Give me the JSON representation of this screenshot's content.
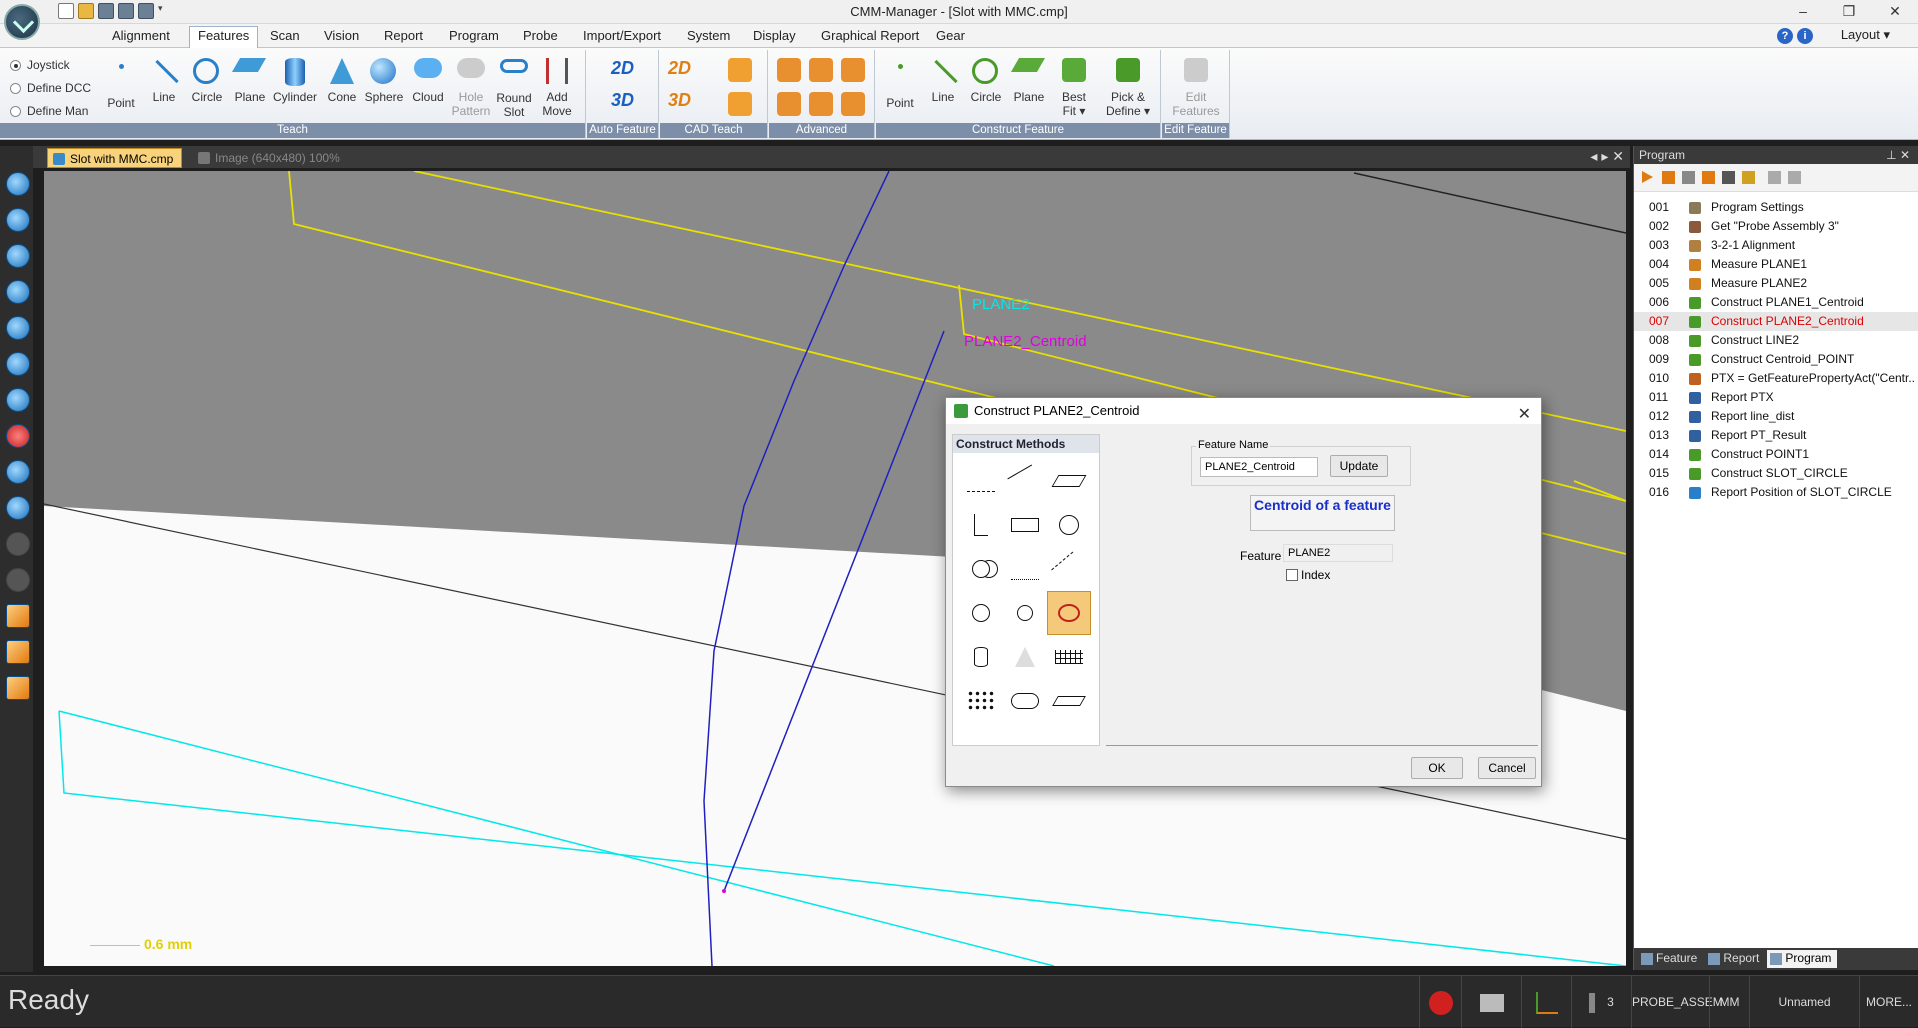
{
  "window": {
    "title": "CMM-Manager - [Slot with MMC.cmp]",
    "layout_label": "Layout",
    "controls": [
      "–",
      "❐",
      "✕"
    ]
  },
  "menu": {
    "items": [
      "Alignment",
      "Features",
      "Scan",
      "Vision",
      "Report",
      "Program",
      "Probe",
      "Import/Export",
      "System",
      "Display",
      "Graphical Report",
      "Gear"
    ],
    "active": "Features"
  },
  "ribbon": {
    "teach_modes": [
      "Joystick",
      "Define DCC",
      "Define Man"
    ],
    "teach_tools": [
      {
        "label": "Point",
        "icon": "point-icon"
      },
      {
        "label": "Line",
        "icon": "line-icon"
      },
      {
        "label": "Circle",
        "icon": "circle-icon"
      },
      {
        "label": "Plane",
        "icon": "plane-icon"
      },
      {
        "label": "Cylinder",
        "icon": "cylinder-icon"
      },
      {
        "label": "Cone",
        "icon": "cone-icon"
      },
      {
        "label": "Sphere",
        "icon": "sphere-icon"
      },
      {
        "label": "Cloud",
        "icon": "cloud-icon"
      },
      {
        "label": "Hole Pattern",
        "icon": "hole-pattern-icon"
      },
      {
        "label": "Round Slot",
        "icon": "round-slot-icon"
      },
      {
        "label": "Add Move",
        "icon": "add-move-icon"
      }
    ],
    "groups": {
      "teach": "Teach",
      "auto_feature": "Auto Feature",
      "cad_teach": "CAD Teach",
      "advanced": "Advanced",
      "construct_feature": "Construct Feature",
      "edit_feature": "Edit Feature"
    },
    "auto_feature_labels": [
      "2D",
      "3D"
    ],
    "cad_labels": [
      "2D",
      "3D"
    ],
    "construct_tools": [
      {
        "label": "Point",
        "icon": "construct-point-icon"
      },
      {
        "label": "Line",
        "icon": "construct-line-icon"
      },
      {
        "label": "Circle",
        "icon": "construct-circle-icon"
      },
      {
        "label": "Plane",
        "icon": "construct-plane-icon"
      },
      {
        "label": "Best Fit",
        "icon": "best-fit-icon"
      },
      {
        "label": "Pick & Define",
        "icon": "pick-define-icon"
      }
    ],
    "edit_features_label": "Edit Features"
  },
  "tabs": {
    "active": "Slot with MMC.cmp",
    "inactive": "Image (640x480) 100%"
  },
  "viewport": {
    "labels": {
      "plane2": "PLANE2",
      "centroid": "PLANE2_Centroid"
    },
    "scale": "0.6 mm",
    "colors": {
      "yellow": "#e8e000",
      "cyan": "#00e8e8",
      "magenta": "#e000e0",
      "blue": "#2020c0",
      "gray": "#8a8a8a"
    }
  },
  "dialog": {
    "title": "Construct PLANE2_Centroid",
    "methods_header": "Construct Methods",
    "feature_name_label": "Feature Name",
    "feature_name_value": "PLANE2_Centroid",
    "update_label": "Update",
    "description": "Centroid of a feature",
    "feature_label": "Feature",
    "feature_value": "PLANE2",
    "index_label": "Index",
    "ok_label": "OK",
    "cancel_label": "Cancel"
  },
  "program": {
    "panel_title": "Program",
    "rows": [
      {
        "num": "001",
        "text": "Program Settings",
        "icon": "wrench-icon",
        "color": "#8a7a5a"
      },
      {
        "num": "002",
        "text": "Get \"Probe Assembly 3\"",
        "icon": "probe-icon",
        "color": "#8a5a3a"
      },
      {
        "num": "003",
        "text": "3-2-1 Alignment",
        "icon": "alignment-icon",
        "color": "#b08040"
      },
      {
        "num": "004",
        "text": "Measure PLANE1",
        "icon": "plane-icon",
        "color": "#d08020"
      },
      {
        "num": "005",
        "text": "Measure PLANE2",
        "icon": "plane-icon",
        "color": "#d08020"
      },
      {
        "num": "006",
        "text": "Construct PLANE1_Centroid",
        "icon": "point-icon",
        "color": "#4a9a2a"
      },
      {
        "num": "007",
        "text": "Construct PLANE2_Centroid",
        "icon": "point-icon",
        "color": "#4a9a2a"
      },
      {
        "num": "008",
        "text": "Construct LINE2",
        "icon": "line-icon",
        "color": "#4a9a2a"
      },
      {
        "num": "009",
        "text": "Construct Centroid_POINT",
        "icon": "point-icon",
        "color": "#4a9a2a"
      },
      {
        "num": "010",
        "text": "PTX = GetFeaturePropertyAct(\"Centr...",
        "icon": "variable-icon",
        "color": "#c06020"
      },
      {
        "num": "011",
        "text": "Report PTX",
        "icon": "report-icon",
        "color": "#3060a0"
      },
      {
        "num": "012",
        "text": "Report line_dist",
        "icon": "report-icon",
        "color": "#3060a0"
      },
      {
        "num": "013",
        "text": "Report PT_Result",
        "icon": "report-icon",
        "color": "#3060a0"
      },
      {
        "num": "014",
        "text": "Construct POINT1",
        "icon": "point-icon",
        "color": "#4a9a2a"
      },
      {
        "num": "015",
        "text": "Construct SLOT_CIRCLE",
        "icon": "circle-icon",
        "color": "#4a9a2a"
      },
      {
        "num": "016",
        "text": "Report Position of SLOT_CIRCLE",
        "icon": "position-icon",
        "color": "#2a80c8"
      }
    ],
    "selected": "007",
    "bottom_tabs": [
      "Feature",
      "Report",
      "Program"
    ],
    "active_bottom_tab": "Program"
  },
  "status": {
    "ready": "Ready",
    "probe_count": "3",
    "probe_name": "PROBE_ASSEM",
    "units": "MM",
    "name": "Unnamed",
    "more": "MORE..."
  }
}
